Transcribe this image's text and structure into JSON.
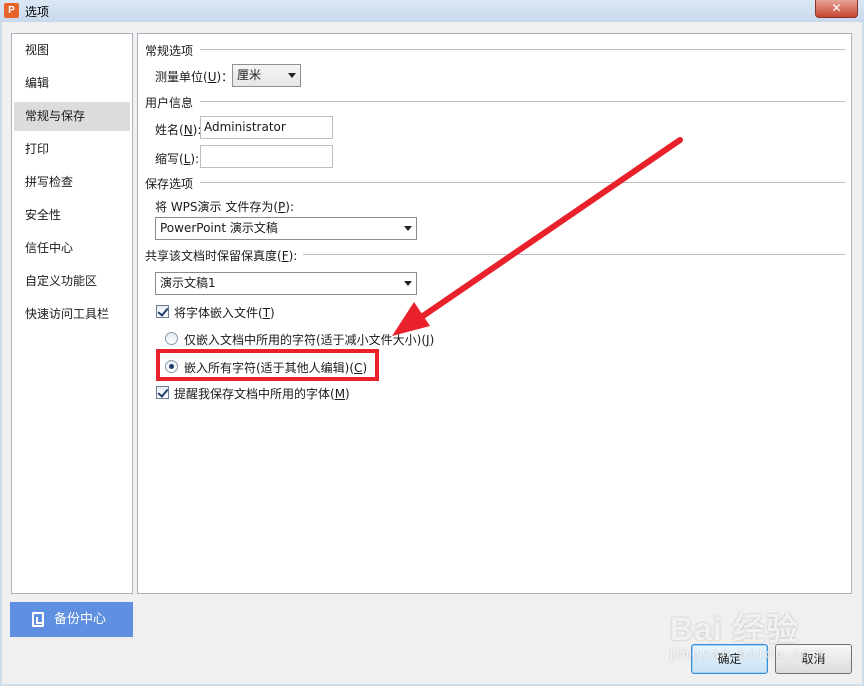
{
  "window": {
    "title": "选项",
    "app_icon_letter": "P",
    "close_glyph": "✕"
  },
  "nav": {
    "items": [
      {
        "label": "视图"
      },
      {
        "label": "编辑"
      },
      {
        "label": "常规与保存"
      },
      {
        "label": "打印"
      },
      {
        "label": "拼写检查"
      },
      {
        "label": "安全性"
      },
      {
        "label": "信任中心"
      },
      {
        "label": "自定义功能区"
      },
      {
        "label": "快速访问工具栏"
      }
    ],
    "active_index": 2,
    "backup_label": "备份中心"
  },
  "general": {
    "section_title": "常规选项",
    "unit_label": "测量单位(",
    "unit_key": "U",
    "unit_label_end": ")：",
    "unit_value": "厘米"
  },
  "user_info": {
    "section_title": "用户信息",
    "name_label": "姓名(",
    "name_key": "N",
    "name_label_end": "):",
    "name_value": "Administrator",
    "initials_label": "缩写(",
    "initials_key": "L",
    "initials_label_end": "):",
    "initials_value": ""
  },
  "save_options": {
    "section_title": "保存选项",
    "save_as_label": "将 WPS演示 文件存为(",
    "save_as_key": "P",
    "save_as_label_end": "):",
    "save_as_value": "PowerPoint 演示文稿"
  },
  "fidelity": {
    "section_title": "共享该文档时保留保真度(",
    "section_key": "F",
    "section_title_end": "):",
    "document_value": "演示文稿1",
    "embed_fonts_label": "将字体嵌入文件(",
    "embed_fonts_key": "T",
    "embed_fonts_end": ")",
    "embed_fonts_checked": true,
    "embed_used_label": "仅嵌入文档中所用的字符(适于减小文件大小)(",
    "embed_used_key": "J",
    "embed_used_end": ")",
    "embed_all_label": "嵌入所有字符(适于其他人编辑)(",
    "embed_all_key": "C",
    "embed_all_end": ")",
    "selected_radio": "embed_all",
    "remind_label": "提醒我保存文档中所用的字体(",
    "remind_key": "M",
    "remind_end": ")",
    "remind_checked": true
  },
  "footer": {
    "ok_label": "确定",
    "cancel_label": "取消"
  },
  "annotation": {
    "color": "#e8212a"
  },
  "watermark": {
    "main": "Bai 经验",
    "sub": "jingyan.baidu.com"
  }
}
